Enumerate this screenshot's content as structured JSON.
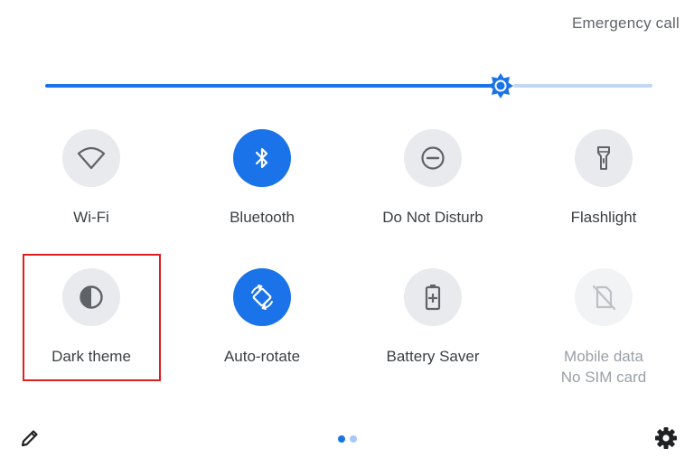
{
  "header": {
    "emergency_call": "Emergency call"
  },
  "brightness": {
    "level": 0.75
  },
  "tiles": [
    {
      "label": "Wi-Fi",
      "icon": "wifi-icon",
      "state": "off"
    },
    {
      "label": "Bluetooth",
      "icon": "bluetooth-icon",
      "state": "on"
    },
    {
      "label": "Do Not Disturb",
      "icon": "do-not-disturb-icon",
      "state": "off"
    },
    {
      "label": "Flashlight",
      "icon": "flashlight-icon",
      "state": "off"
    },
    {
      "label": "Dark theme",
      "icon": "dark-theme-icon",
      "state": "off"
    },
    {
      "label": "Auto-rotate",
      "icon": "auto-rotate-icon",
      "state": "on"
    },
    {
      "label": "Battery Saver",
      "icon": "battery-saver-icon",
      "state": "off"
    },
    {
      "label": "Mobile data",
      "sublabel": "No SIM card",
      "icon": "mobile-data-off-icon",
      "state": "disabled"
    }
  ],
  "footer": {
    "edit_icon": "pencil-icon",
    "settings_icon": "gear-icon",
    "pages": 2,
    "current_page": 1
  },
  "colors": {
    "accent": "#1a73e8",
    "tile_off": "#e8eaed",
    "highlight": "#e02020"
  }
}
